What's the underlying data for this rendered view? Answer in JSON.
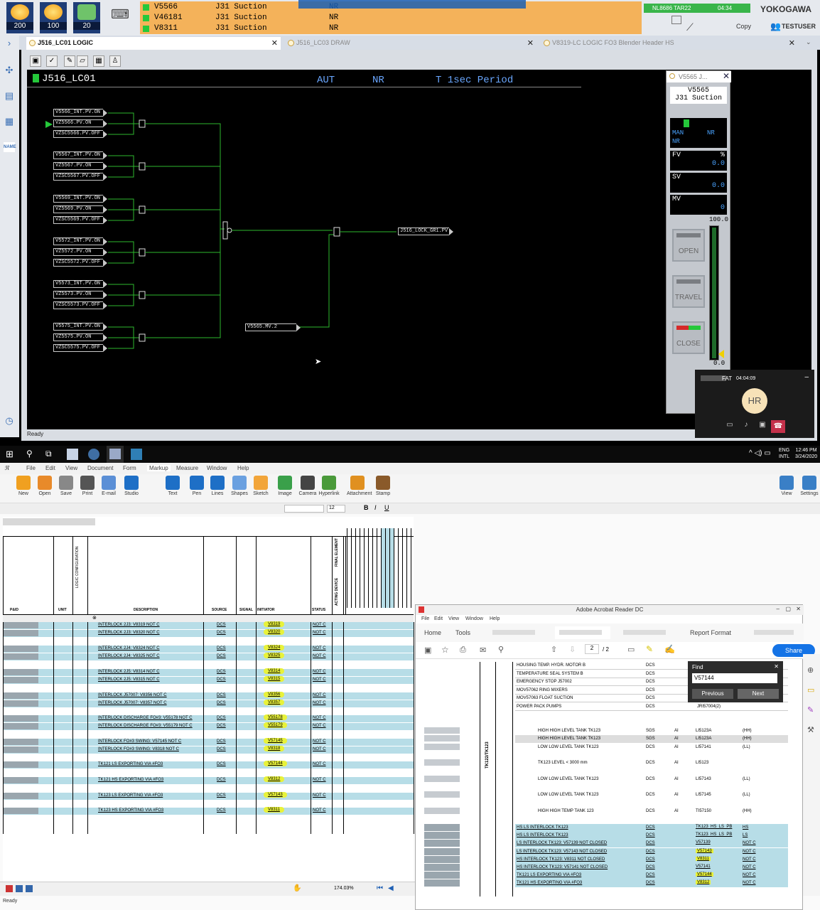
{
  "top": {
    "alarm_counts": [
      "200",
      "100",
      "20"
    ],
    "alarms": [
      {
        "tag": "V5566",
        "desc": "J31 Suction",
        "status": "NR"
      },
      {
        "tag": "V46181",
        "desc": "J31 Suction",
        "status": "NR"
      },
      {
        "tag": "V8311",
        "desc": "J31 Suction",
        "status": "NR"
      }
    ],
    "station": "NL8686 TAR22",
    "time": "04:34",
    "brand": "YOKOGAWA",
    "copy_label": "Copy",
    "user": "TESTUSER",
    "sidebar_name": "NAME"
  },
  "tabs": [
    {
      "label": "J516_LC01 LOGIC"
    },
    {
      "label": "J516_LC03 DRAW"
    },
    {
      "label": "V8319-LC LOGIC  FO3 Blender Header HS"
    }
  ],
  "logic": {
    "title": "J516_LC01",
    "mode": "AUT",
    "status": "NR",
    "period": "T 1sec Period",
    "output_tag": "J516_LOCK_GR1.PV",
    "mv_tag": "V5565.MV.2",
    "groups": [
      [
        "V5566_INT.PV.ON",
        "VZ5566.PV.ON",
        "VZSC5566.PV.OFF"
      ],
      [
        "V5567_INT.PV.ON",
        "VZ5567.PV.ON",
        "VZSC5567.PV.OFF"
      ],
      [
        "V5569_INT.PV.ON",
        "VZ5569.PV.ON",
        "VZSC5569.PV.OFF"
      ],
      [
        "V5572_INT.PV.ON",
        "VZ5572.PV.ON",
        "VZSC5572.PV.OFF"
      ],
      [
        "V5573_INT.PV.ON",
        "VZ5573.PV.ON",
        "VZSC5573.PV.OFF"
      ],
      [
        "V5575_INT.PV.ON",
        "VZ5575.PV.ON",
        "VZSC5575.PV.OFF"
      ]
    ],
    "ready": "Ready"
  },
  "faceplate": {
    "header": "V5565 J...",
    "tag": "V5565",
    "desc": "J31 Suction",
    "mode1": "MAN",
    "mode2": "NR",
    "mode3": "NR",
    "fv_label": "FV",
    "fv_unit": "%",
    "fv_value": "0.0",
    "sv_label": "SV",
    "sv_value": "0.0",
    "mv_label": "MV",
    "mv_value": "0",
    "scale_hi": "100.0",
    "scale_lo": "0.0",
    "btn_open": "OPEN",
    "btn_travel": "TRAVEL",
    "btn_close": "CLOSE"
  },
  "call": {
    "title": "FAT",
    "duration": "04:04:09",
    "initials": "HR"
  },
  "taskbar": {
    "lang1": "ENG",
    "lang2": "INTL",
    "clock": "12:46 PM",
    "date": "3/24/2020"
  },
  "revu": {
    "menu": [
      "File",
      "Edit",
      "View",
      "Document",
      "Form",
      "Markup",
      "Measure",
      "Window",
      "Help"
    ],
    "tools": [
      "New",
      "Open",
      "Save",
      "Print",
      "E-mail",
      "Studio",
      "Text",
      "Pen",
      "Lines",
      "Shapes",
      "Sketch",
      "Image",
      "Camera",
      "Hyperlink",
      "Attachment",
      "Stamp"
    ],
    "right_tools": [
      "View",
      "Settings"
    ],
    "font_size": "12",
    "col_headers": [
      "P&ID",
      "UNIT",
      "LOGIC CONFIGURATION",
      "DESCRIPTION",
      "SOURCE",
      "SIGNAL",
      "INITIATOR",
      "STATUS"
    ],
    "vert_headers": [
      "FINAL ELEMENT",
      "ACTING DEVICE"
    ],
    "rows": [
      {
        "desc": "INTERLOCK 2J3: V8319 NOT C",
        "src": "DCS",
        "init": "V8319",
        "status": "NOT C"
      },
      {
        "desc": "INTERLOCK 2J3: V8320 NOT C",
        "src": "DCS",
        "init": "V8320",
        "status": "NOT C"
      },
      {
        "desc": "INTERLOCK 2J4: V8324 NOT C",
        "src": "DCS",
        "init": "V8324",
        "status": "NOT C"
      },
      {
        "desc": "INTERLOCK 2J4: V8325 NOT C",
        "src": "DCS",
        "init": "V8325",
        "status": "NOT C"
      },
      {
        "desc": "INTERLOCK 2J5: V8314 NOT C",
        "src": "DCS",
        "init": "V8314",
        "status": "NOT C"
      },
      {
        "desc": "INTERLOCK 2J5: V8315 NOT C",
        "src": "DCS",
        "init": "V8315",
        "status": "NOT C"
      },
      {
        "desc": "INTERLOCK J57007: V8356 NOT C",
        "src": "DCS",
        "init": "V8356",
        "status": "NOT C"
      },
      {
        "desc": "INTERLOCK J57007: V8357 NOT C",
        "src": "DCS",
        "init": "V8357",
        "status": "NOT C"
      },
      {
        "desc": "INTERLOCK DISCHARGE FO#3: V55178 NOT C",
        "src": "DCS",
        "init": "V55178",
        "status": "NOT C"
      },
      {
        "desc": "INTERLOCK DISCHARGE FO#3: V55179 NOT C",
        "src": "DCS",
        "init": "V55179",
        "status": "NOT C"
      },
      {
        "desc": "INTERLOCK FO#3 SWING: V57145 NOT C",
        "src": "DCS",
        "init": "V57145",
        "status": "NOT C"
      },
      {
        "desc": "INTERLOCK FO#3 SWING: V8318 NOT C",
        "src": "DCS",
        "init": "V8318",
        "status": "NOT C"
      },
      {
        "desc": "TK121 LS EXPORTING VIA #FO3",
        "src": "DCS",
        "init": "V57144",
        "status": "NOT C"
      },
      {
        "desc": "TK121 HS EXPORTING VIA #FO3",
        "src": "DCS",
        "init": "V8312",
        "status": "NOT C"
      },
      {
        "desc": "TK123 LS EXPORTING VIA #FO3",
        "src": "DCS",
        "init": "V57143",
        "status": "NOT C"
      },
      {
        "desc": "TK123 HS EXPORTING VIA #FO3",
        "src": "DCS",
        "init": "V8311",
        "status": "NOT C"
      }
    ],
    "zoom": "174.03%",
    "ready": "Ready"
  },
  "acrobat": {
    "title": "Adobe Acrobat Reader DC",
    "menu": [
      "File",
      "Edit",
      "View",
      "Window",
      "Help"
    ],
    "nav": [
      "Home",
      "Tools",
      "Report Format"
    ],
    "page_current": "2",
    "page_total": "/ 2",
    "share": "Share",
    "side_label": "TK122/TK123",
    "find": {
      "title": "Find",
      "value": "V57144",
      "prev": "Previous",
      "next": "Next"
    },
    "top_rows": [
      {
        "desc": "HOUSING TEMP. HYDR. MOTOR B",
        "src": "DCS"
      },
      {
        "desc": "TEMPERATURE SEAL SYSTEM B",
        "src": "DCS"
      },
      {
        "desc": "EMERGENCY STOP J57002",
        "src": "DCS"
      },
      {
        "desc": "MOV57062 RING MIXERS",
        "src": "DCS"
      },
      {
        "desc": "MOV57063 FLOAT SUCTION",
        "src": "DCS"
      },
      {
        "desc": "POWER PACK PUMPS",
        "src": "DCS",
        "init": "JRI57004(2)"
      }
    ],
    "mid_rows": [
      {
        "desc": "HIGH HIGH LEVEL TANK TK123",
        "src": "SGS",
        "sig": "AI",
        "init": "LI5123A",
        "st": "(HH)"
      },
      {
        "desc": "HIGH HIGH LEVEL TANK TK123",
        "src": "SGS",
        "sig": "AI",
        "init": "LI5123A",
        "st": "(HH)"
      },
      {
        "desc": "LOW LOW LEVEL TANK TK123",
        "src": "DCS",
        "sig": "AI",
        "init": "LI57141",
        "st": "(LL)"
      },
      {
        "desc": "TK123 LEVEL < 3000 mm",
        "src": "DCS",
        "sig": "AI",
        "init": "LI5123",
        "st": ""
      },
      {
        "desc": "LOW LOW LEVEL TANK TK123",
        "src": "DCS",
        "sig": "AI",
        "init": "LI57143",
        "st": "(LL)"
      },
      {
        "desc": "LOW LOW LEVEL TANK TK123",
        "src": "DCS",
        "sig": "AI",
        "init": "LI57145",
        "st": "(LL)"
      },
      {
        "desc": "HIGH HIGH TEMP TANK 123",
        "src": "DCS",
        "sig": "AI",
        "init": "TI57150",
        "st": "(HH)"
      }
    ],
    "bottom_rows": [
      {
        "desc": "HS LS INTERLOCK TK123",
        "src": "DCS",
        "init": "TK123_HS_LS_PB",
        "st": "HS"
      },
      {
        "desc": "HS LS INTERLOCK TK123",
        "src": "DCS",
        "init": "TK123_HS_LS_PB",
        "st": "LS"
      },
      {
        "desc": "LS INTERLOCK TK123: V57139 NOT CLOSED",
        "src": "DCS",
        "init": "V57139",
        "st": "NOT C"
      },
      {
        "desc": "LS INTERLOCK TK123: V57143 NOT CLOSED",
        "src": "DCS",
        "init": "V57143",
        "st": "NOT C"
      },
      {
        "desc": "HS INTERLOCK TK123: V8311 NOT CLOSED",
        "src": "DCS",
        "init": "V8311",
        "st": "NOT C"
      },
      {
        "desc": "HS INTERLOCK TK123: V57141 NOT CLOSED",
        "src": "DCS",
        "init": "V57141",
        "st": "NOT C"
      },
      {
        "desc": "TK121 LS EXPORTING VIA #FO3",
        "src": "DCS",
        "init": "V57144",
        "st": "NOT C"
      },
      {
        "desc": "TK121 HS EXPORTING VIA #FO3",
        "src": "DCS",
        "init": "V8312",
        "st": "NOT C"
      }
    ]
  },
  "colors": {
    "accent": "#1f3d77",
    "alarm_bg": "#f4b25a",
    "logic_line": "#2eb82e",
    "highlight": "#e8f23a",
    "row_blue": "#b7dde7"
  }
}
